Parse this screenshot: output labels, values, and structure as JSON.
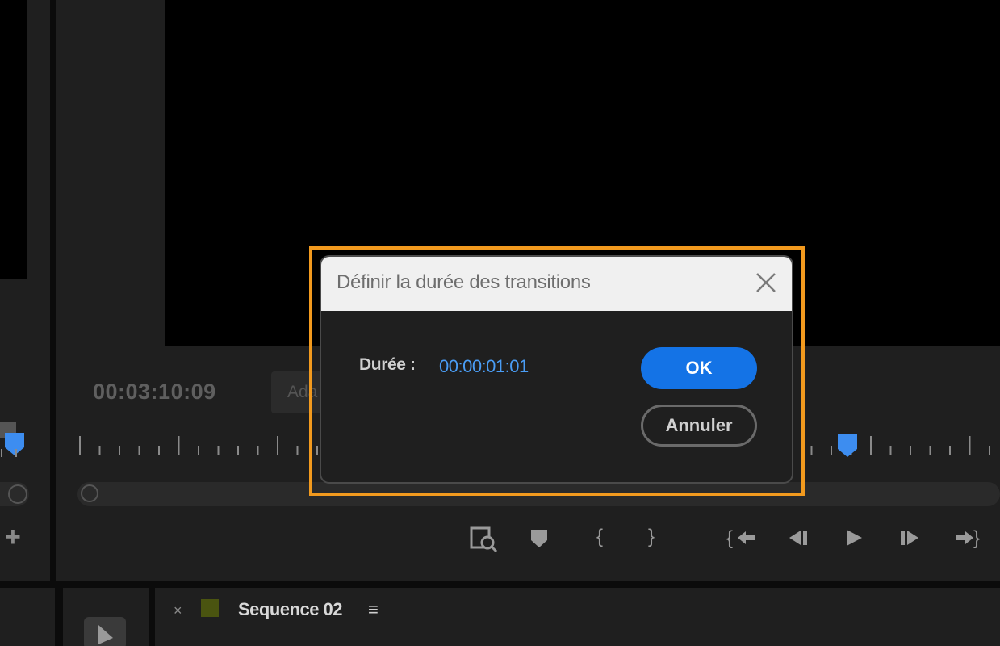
{
  "program_monitor": {
    "timecode": "00:03:10:09",
    "fit_dropdown_value": "Ada"
  },
  "timeline_panel": {
    "sequence_tab_label": "Sequence 02",
    "close_glyph": "×",
    "menu_glyph": "≡"
  },
  "dialog": {
    "title": "Définir la durée des transitions",
    "duration_label": "Durée :",
    "duration_value": "00:00:01:01",
    "ok_label": "OK",
    "cancel_label": "Annuler"
  },
  "controls": [
    {
      "name": "export-frame-icon",
      "glyph": "◰"
    },
    {
      "name": "add-marker-icon",
      "glyph": "⬟"
    },
    {
      "name": "mark-in-icon",
      "glyph": "{"
    },
    {
      "name": "mark-out-icon",
      "glyph": "}"
    },
    {
      "name": "go-to-in-icon",
      "glyph": "{←"
    },
    {
      "name": "step-back-icon",
      "glyph": "◂|"
    },
    {
      "name": "play-icon",
      "glyph": "▶"
    },
    {
      "name": "step-forward-icon",
      "glyph": "|▸"
    },
    {
      "name": "go-to-out-icon",
      "glyph": "→}"
    }
  ],
  "colors": {
    "accent_blue": "#1473e6",
    "timecode_blue": "#4a9df5",
    "highlight_orange": "#f29a1e",
    "playhead_blue": "#3d8df0"
  }
}
